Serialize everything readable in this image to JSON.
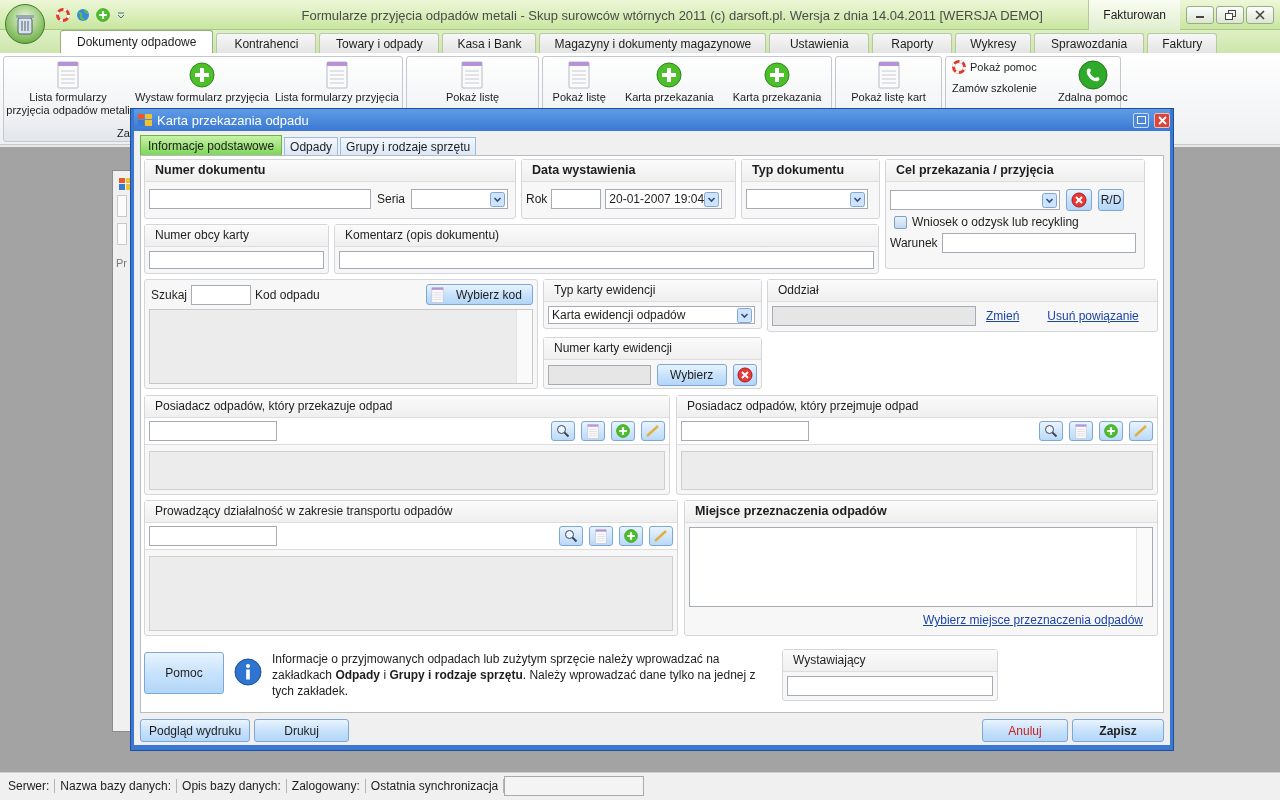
{
  "app_window": {
    "title": "Formularze przyjęcia odpadów metali - Skup surowców wtórnych 2011 (c) darsoft.pl. Wersja z dnia 14.04.2011 [WERSJA DEMO]",
    "user_label": "Fakturowan"
  },
  "ribbon_tabs": [
    {
      "label": "Dokumenty odpadowe",
      "selected": true
    },
    {
      "label": "Kontrahenci",
      "selected": false
    },
    {
      "label": "Towary i odpady",
      "selected": false
    },
    {
      "label": "Kasa i Bank",
      "selected": false
    },
    {
      "label": "Magazyny i dokumenty magazynowe",
      "selected": false
    },
    {
      "label": "Ustawienia",
      "selected": false
    },
    {
      "label": "Raporty",
      "selected": false
    },
    {
      "label": "Wykresy",
      "selected": false
    },
    {
      "label": "Sprawozdania",
      "selected": false
    },
    {
      "label": "Faktury",
      "selected": false
    }
  ],
  "ribbon_groups": [
    {
      "kind": "buttons",
      "label": "Za",
      "buttons": [
        {
          "lines": [
            "Lista formularzy",
            "przyjęcia odpadów metali"
          ],
          "kind": "list"
        },
        {
          "lines": [
            "Wystaw formularz przyjęcia"
          ],
          "kind": "add"
        },
        {
          "lines": [
            "Lista formularzy przyjęcia"
          ],
          "kind": "list"
        }
      ]
    },
    {
      "kind": "buttons",
      "buttons": [
        {
          "lines": [
            "Pokaż listę"
          ],
          "kind": "list"
        }
      ]
    },
    {
      "kind": "buttons",
      "buttons": [
        {
          "lines": [
            "Pokaż listę"
          ],
          "kind": "list"
        },
        {
          "lines": [
            "Karta przekazania"
          ],
          "kind": "add"
        },
        {
          "lines": [
            "Karta przekazania"
          ],
          "kind": "add"
        }
      ]
    },
    {
      "kind": "buttons",
      "buttons": [
        {
          "lines": [
            "Pokaż listę kart"
          ],
          "kind": "list"
        }
      ]
    },
    {
      "kind": "help",
      "links": [
        {
          "label": "Pokaż pomoc",
          "kind": "help"
        },
        {
          "label": "Zamów szkolenie",
          "kind": "plain"
        }
      ],
      "buttons": [
        {
          "lines": [
            "Zdalna pomoc"
          ],
          "kind": "phone"
        }
      ]
    }
  ],
  "background_window": {
    "text": "Pr"
  },
  "dialog": {
    "title": "Karta przekazania odpadu",
    "tabs": [
      {
        "label": "Informacje podstawowe",
        "selected": true
      },
      {
        "label": "Odpady",
        "selected": false
      },
      {
        "label": "Grupy i rodzaje sprzętu",
        "selected": false
      }
    ],
    "numer_dokumentu": {
      "title": "Numer dokumentu",
      "seria_label": "Seria"
    },
    "data_wystawienia": {
      "title": "Data wystawienia",
      "rok_label": "Rok",
      "date": "20-01-2007 19:04"
    },
    "typ_dokumentu": {
      "title": "Typ dokumentu"
    },
    "cel": {
      "title": "Cel przekazania / przyjęcia",
      "rd_button": "R/D",
      "checkbox": {
        "label": "Wniosek o odzysk lub recykling",
        "checked": false
      },
      "warunek_label": "Warunek"
    },
    "numer_obcy": {
      "title": "Numer obcy karty"
    },
    "komentarz": {
      "title": "Komentarz (opis dokumentu)"
    },
    "kod_odpadu": {
      "search_label": "Szukaj",
      "label": "Kod odpadu",
      "button": "Wybierz kod"
    },
    "typ_karty": {
      "title": "Typ karty ewidencji",
      "value": "Karta ewidencji odpadów"
    },
    "numer_karty": {
      "title": "Numer karty ewidencji",
      "button": "Wybierz"
    },
    "oddzial": {
      "title": "Oddział",
      "links": [
        "Zmień",
        "Usuń powiązanie"
      ]
    },
    "holders": [
      {
        "title": "Posiadacz odpadów, który przekazuje odpad"
      },
      {
        "title": "Posiadacz odpadów, który przejmuje odpad"
      }
    ],
    "transport": {
      "title": "Prowadzący działalność w zakresie transportu odpadów"
    },
    "miejsce": {
      "title": "Miejsce przeznaczenia odpadów",
      "link": "Wybierz miejsce przeznaczenia odpadów"
    },
    "help_button": "Pomoc",
    "info_text": "Informacje o przyjmowanych odpadach lub zużytym sprzęcie należy wprowadzać na zakładkach **Odpady** i **Grupy i rodzaje sprzętu**. Należy wprowadzać dane tylko na jednej z tych zakładek.",
    "wystawiajacy": {
      "title": "Wystawiający"
    },
    "footer_buttons": [
      {
        "label": "Podgląd wydruku",
        "kind": "normal"
      },
      {
        "label": "Drukuj",
        "kind": "normal"
      },
      {
        "label": "Anuluj",
        "kind": "cancel"
      },
      {
        "label": "Zapisz",
        "kind": "primary"
      }
    ]
  },
  "status_bar": {
    "items": [
      "Serwer:",
      "Nazwa bazy danych:",
      "Opis bazy danych:",
      "Zalogowany:",
      "Ostatnia synchronizacja"
    ]
  }
}
